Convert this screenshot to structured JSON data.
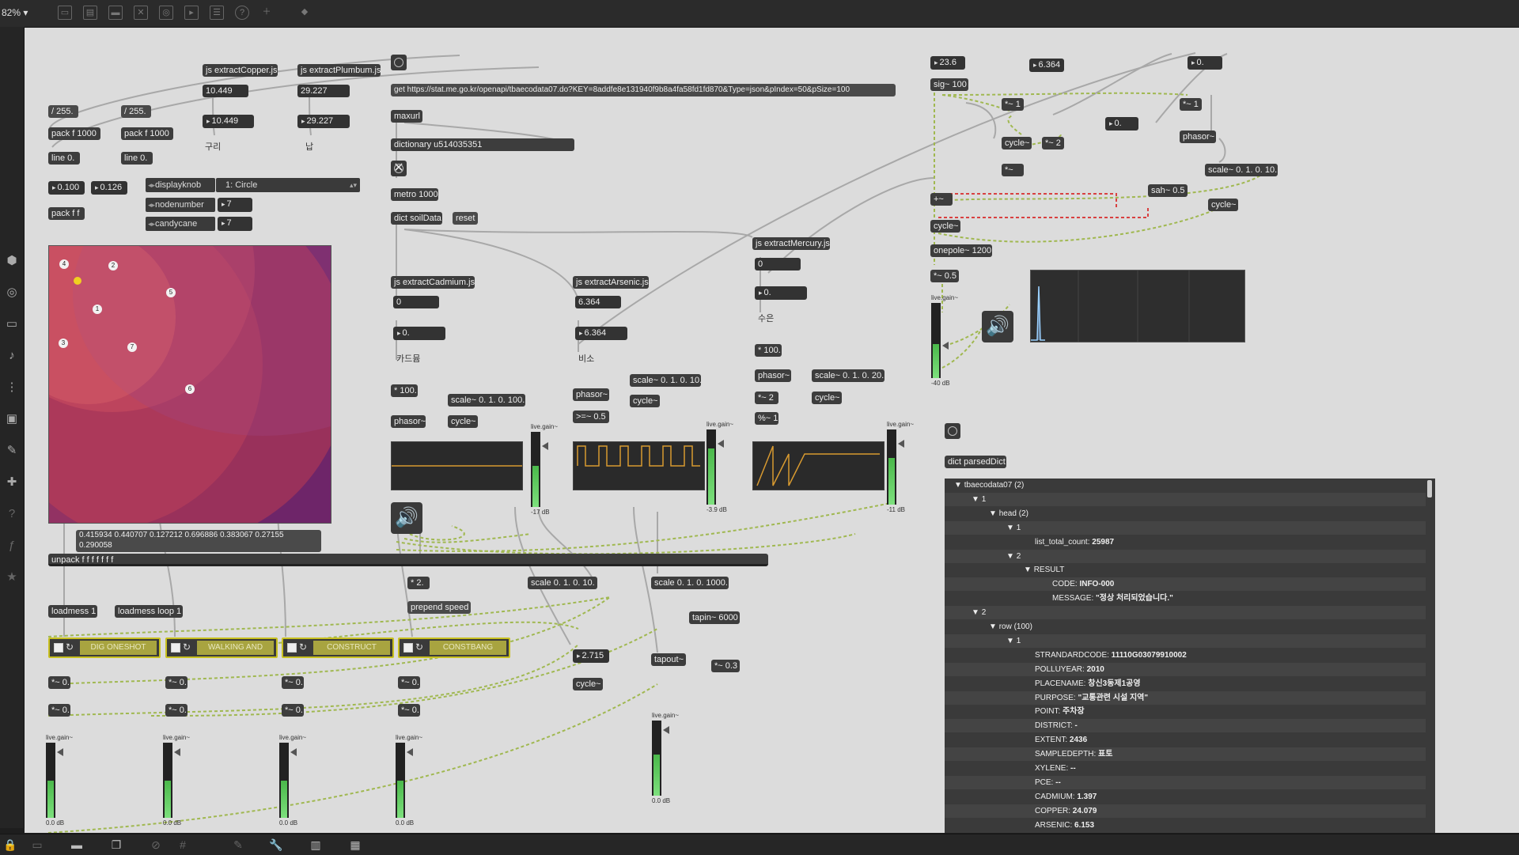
{
  "toolbar": {
    "zoom": "82%",
    "icons": [
      "presentation-icon",
      "patcher-icon",
      "comment-icon",
      "close-box-icon",
      "target-icon",
      "image-icon",
      "layout-icon",
      "help-icon",
      "add-icon",
      "paint-icon"
    ]
  },
  "leftbar": {
    "icons": [
      "objects-icon",
      "target-icon",
      "keyboard-icon",
      "music-icon",
      "step-icon",
      "image-icon",
      "clip-icon",
      "puzzle-icon",
      "help-icon",
      "script-icon",
      "star-icon"
    ]
  },
  "bottombar": {
    "icons": [
      "lock-icon",
      "presentation-icon",
      "console-icon",
      "windows-icon",
      "debug-icon",
      "grid-icon",
      "pen-icon",
      "wrench-icon",
      "piano-icon",
      "keyboard-icon"
    ]
  },
  "objects": {
    "o_extractCopper": "js extractCopper.js",
    "o_extractPlumbum": "js extractPlumbum.js",
    "o_div255a": "/ 255.",
    "o_div255b": "/ 255.",
    "o_packf1000a": "pack f 1000",
    "o_packf1000b": "pack f 1000",
    "o_line0a": "line 0.",
    "o_line0b": "line 0.",
    "o_packff": "pack f f",
    "o_getUrl": "get https://stat.me.go.kr/openapi/tbaecodata07.do?KEY=8addfe8e131940f9b8a4fa58fd1fd870&Type=json&pIndex=50&pSize=100",
    "o_maxurl": "maxurl",
    "o_dictionary": "dictionary u514035351",
    "o_metro": "metro 1000",
    "o_dictSoil": "dict soilData",
    "o_reset": "reset",
    "o_extractCadmium": "js extractCadmium.js",
    "o_extractArsenic": "js extractArsenic.js",
    "o_extractMercury": "js extractMercury.js",
    "o_times100a": "* 100.",
    "o_times100b": "* 100.",
    "o_phasorA": "phasor~",
    "o_cycleA": "cycle~",
    "o_scaleA": "scale~ 0. 1. 0. 100.",
    "o_phasorB": "phasor~",
    "o_gteB": ">=~ 0.5",
    "o_scaleB": "scale~ 0. 1. 0. 10.",
    "o_cycleB": "cycle~",
    "o_phasorC": "phasor~",
    "o_times2C": "*~ 2",
    "o_mod1C": "%~ 1.",
    "o_scaleC": "scale~ 0. 1. 0. 20.",
    "o_cycleC": "cycle~",
    "o_sig100": "sig~ 100",
    "o_times1a": "*~ 1",
    "o_times1b": "*~ 1",
    "o_cycleD": "cycle~",
    "o_times2D": "*~ 2",
    "o_timesD": "*~",
    "o_phasorD": "phasor~",
    "o_scaleD": "scale~ 0. 1. 0. 10.",
    "o_sah": "sah~ 0.5",
    "o_plusD": "+~",
    "o_cycleE": "cycle~",
    "o_cycleF": "cycle~",
    "o_onepole": "onepole~ 1200",
    "o_times05": "*~ 0.5",
    "o_dictParsed": "dict parsedDict",
    "o_unpack": "unpack f f f f f f f",
    "o_loadmess1": "loadmess 1",
    "o_loadmessLoop1": "loadmess loop 1",
    "o_times2": "* 2.",
    "o_prependSpeed": "prepend speed",
    "o_scale010": "scale 0. 1. 0. 10.",
    "o_scale01000": "scale 0. 1. 0. 1000.",
    "o_tapin": "tapin~ 6000",
    "o_tapout": "tapout~",
    "o_times03": "*~ 0.3",
    "o_cycleG": "cycle~",
    "o_t0_1": "*~ 0.",
    "o_t0_2": "*~ 0.",
    "o_t0_3": "*~ 0.",
    "o_t0_4": "*~ 0.",
    "o_t0_5": "*~ 0.",
    "o_t0_6": "*~ 0.",
    "o_t0_7": "*~ 0.",
    "o_t0_8": "*~ 0."
  },
  "numbers": {
    "n_copper1": "10.449",
    "n_copper2": "10.449",
    "n_plumbum1": "29.227",
    "n_plumbum2": "29.227",
    "n_0100": "0.100",
    "n_0126": "0.126",
    "n_cad1": "0",
    "n_cad2": "0.",
    "n_ars1": "6.364",
    "n_ars2": "6.364",
    "n_merc1": "0",
    "n_merc2": "0.",
    "n_236": "23.6",
    "n_6364": "6.364",
    "n_0a": "0.",
    "n_0b": "0.",
    "n_2715": "2.715",
    "n_node7a": "7",
    "n_node7b": "7"
  },
  "labels": {
    "l_copper": "구리",
    "l_plumbum": "납",
    "l_cadmium": "카드뮴",
    "l_arsenic": "비소",
    "l_mercury": "수은"
  },
  "menus": {
    "displayknob": "displayknob",
    "circle": "1: Circle",
    "nodenumber": "nodenumber",
    "candycane": "candycane"
  },
  "nodes_list": "0.415934 0.440707 0.127212 0.696886 0.383067 0.27155 0.290058",
  "node_labels": [
    "4",
    "2",
    "1",
    "5",
    "3",
    "7",
    "6"
  ],
  "players": [
    "DIG ONESHOT",
    "WALKING AND",
    "CONSTRUCT",
    "CONSTBANG"
  ],
  "gains": {
    "g1": {
      "label": "live.gain~",
      "db": "-17 dB",
      "level": 0.55
    },
    "g2": {
      "label": "live.gain~",
      "db": "-3.9 dB",
      "level": 0.75
    },
    "g3": {
      "label": "live.gain~",
      "db": "-11 dB",
      "level": 0.62
    },
    "g4": {
      "label": "live.gain~",
      "db": "-40 dB",
      "level": 0.45
    },
    "g5": {
      "label": "live.gain~",
      "db": "0.0 dB",
      "level": 0.5
    },
    "g6": {
      "label": "live.gain~",
      "db": "0.0 dB",
      "level": 0.5
    },
    "g7": {
      "label": "live.gain~",
      "db": "0.0 dB",
      "level": 0.5
    },
    "g8": {
      "label": "live.gain~",
      "db": "0.0 dB",
      "level": 0.5
    },
    "g9": {
      "label": "live.gain~",
      "db": "0.0 dB",
      "level": 0.55
    }
  },
  "tree": [
    {
      "indent": 0,
      "arrow": "▼",
      "text": "tbaecodata07 (2)",
      "bold": ""
    },
    {
      "indent": 1,
      "arrow": "▼",
      "text": "1",
      "bold": ""
    },
    {
      "indent": 2,
      "arrow": "▼",
      "text": "head (2)",
      "bold": ""
    },
    {
      "indent": 3,
      "arrow": "▼",
      "text": "1",
      "bold": ""
    },
    {
      "indent": 4,
      "arrow": "",
      "text": "list_total_count:",
      "bold": "25987"
    },
    {
      "indent": 3,
      "arrow": "▼",
      "text": "2",
      "bold": ""
    },
    {
      "indent": 4,
      "arrow": "▼",
      "text": "RESULT",
      "bold": ""
    },
    {
      "indent": 5,
      "arrow": "",
      "text": "CODE:",
      "bold": "INFO-000"
    },
    {
      "indent": 5,
      "arrow": "",
      "text": "MESSAGE:",
      "bold": "\"정상 처리되었습니다.\""
    },
    {
      "indent": 1,
      "arrow": "▼",
      "text": "2",
      "bold": ""
    },
    {
      "indent": 2,
      "arrow": "▼",
      "text": "row (100)",
      "bold": ""
    },
    {
      "indent": 3,
      "arrow": "▼",
      "text": "1",
      "bold": ""
    },
    {
      "indent": 4,
      "arrow": "",
      "text": "STRANDARDCODE:",
      "bold": "11110G03079910002"
    },
    {
      "indent": 4,
      "arrow": "",
      "text": "POLLUYEAR:",
      "bold": "2010"
    },
    {
      "indent": 4,
      "arrow": "",
      "text": "PLACENAME:",
      "bold": "창신3동제1공영"
    },
    {
      "indent": 4,
      "arrow": "",
      "text": "PURPOSE:",
      "bold": "\"교통관련 시설 지역\""
    },
    {
      "indent": 4,
      "arrow": "",
      "text": "POINT:",
      "bold": "주차장"
    },
    {
      "indent": 4,
      "arrow": "",
      "text": "DISTRICT:",
      "bold": "-"
    },
    {
      "indent": 4,
      "arrow": "",
      "text": "EXTENT:",
      "bold": "2436"
    },
    {
      "indent": 4,
      "arrow": "",
      "text": "SAMPLEDEPTH:",
      "bold": "표토"
    },
    {
      "indent": 4,
      "arrow": "",
      "text": "XYLENE:",
      "bold": "--"
    },
    {
      "indent": 4,
      "arrow": "",
      "text": "PCE:",
      "bold": "--"
    },
    {
      "indent": 4,
      "arrow": "",
      "text": "CADMIUM:",
      "bold": "1.397"
    },
    {
      "indent": 4,
      "arrow": "",
      "text": "COPPER:",
      "bold": "24.079"
    },
    {
      "indent": 4,
      "arrow": "",
      "text": "ARSENIC:",
      "bold": "6.153"
    }
  ],
  "colors": {
    "canvas": "#dcdcdc",
    "object": "#3d3d3d",
    "patchcord_signal": "#a0b850",
    "patchcord_red": "#d84040",
    "node_bg": "#6e2569",
    "player_border": "#c8c020",
    "meter_green": "#5fd35f",
    "scope_line": "#d89a30"
  }
}
